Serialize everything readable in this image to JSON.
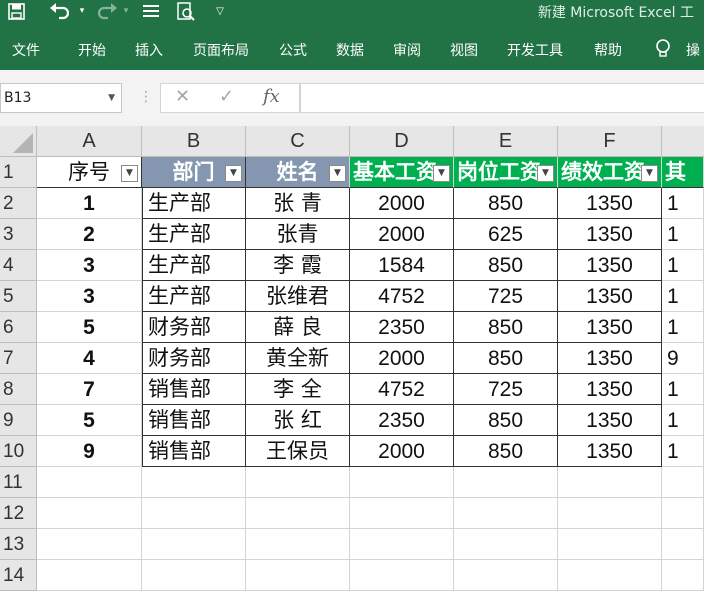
{
  "quick_access": {
    "save_icon": "save-icon",
    "undo_icon": "undo-icon",
    "redo_icon": "redo-icon",
    "menu_icon": "menu-icon",
    "preview_icon": "print-preview-icon",
    "customize_icon": "chevron-down-icon"
  },
  "app_title": "新建 Microsoft Excel 工",
  "ribbon_tabs": [
    "文件",
    "开始",
    "插入",
    "页面布局",
    "公式",
    "数据",
    "审阅",
    "视图",
    "开发工具",
    "帮助"
  ],
  "tell_me": {
    "icon": "lightbulb-icon",
    "label": "操"
  },
  "name_box": "B13",
  "fx_label": "fx",
  "formula_value": "",
  "columns": [
    "A",
    "B",
    "C",
    "D",
    "E",
    "F",
    ""
  ],
  "row_numbers": [
    "1",
    "2",
    "3",
    "4",
    "5",
    "6",
    "7",
    "8",
    "9",
    "10",
    "11",
    "12",
    "13",
    "14"
  ],
  "table": {
    "headers": [
      "序号",
      "部门",
      "姓名",
      "基本工资",
      "岗位工资",
      "绩效工资",
      "其"
    ],
    "rows": [
      [
        "1",
        "生产部",
        "张 青",
        "2000",
        "850",
        "1350",
        "1"
      ],
      [
        "2",
        "生产部",
        "张青",
        "2000",
        "625",
        "1350",
        "1"
      ],
      [
        "3",
        "生产部",
        "李 霞",
        "1584",
        "850",
        "1350",
        "1"
      ],
      [
        "3",
        "生产部",
        "张维君",
        "4752",
        "725",
        "1350",
        "1"
      ],
      [
        "5",
        "财务部",
        "薛 良",
        "2350",
        "850",
        "1350",
        "1"
      ],
      [
        "4",
        "财务部",
        "黄全新",
        "2000",
        "850",
        "1350",
        "9"
      ],
      [
        "7",
        "销售部",
        "李 全",
        "4752",
        "725",
        "1350",
        "1"
      ],
      [
        "5",
        "销售部",
        "张 红",
        "2350",
        "850",
        "1350",
        "1"
      ],
      [
        "9",
        "销售部",
        "王保员",
        "2000",
        "850",
        "1350",
        "1"
      ]
    ]
  },
  "colors": {
    "ribbon": "#217346",
    "header_blue": "#8496b0",
    "header_green": "#00b050"
  }
}
